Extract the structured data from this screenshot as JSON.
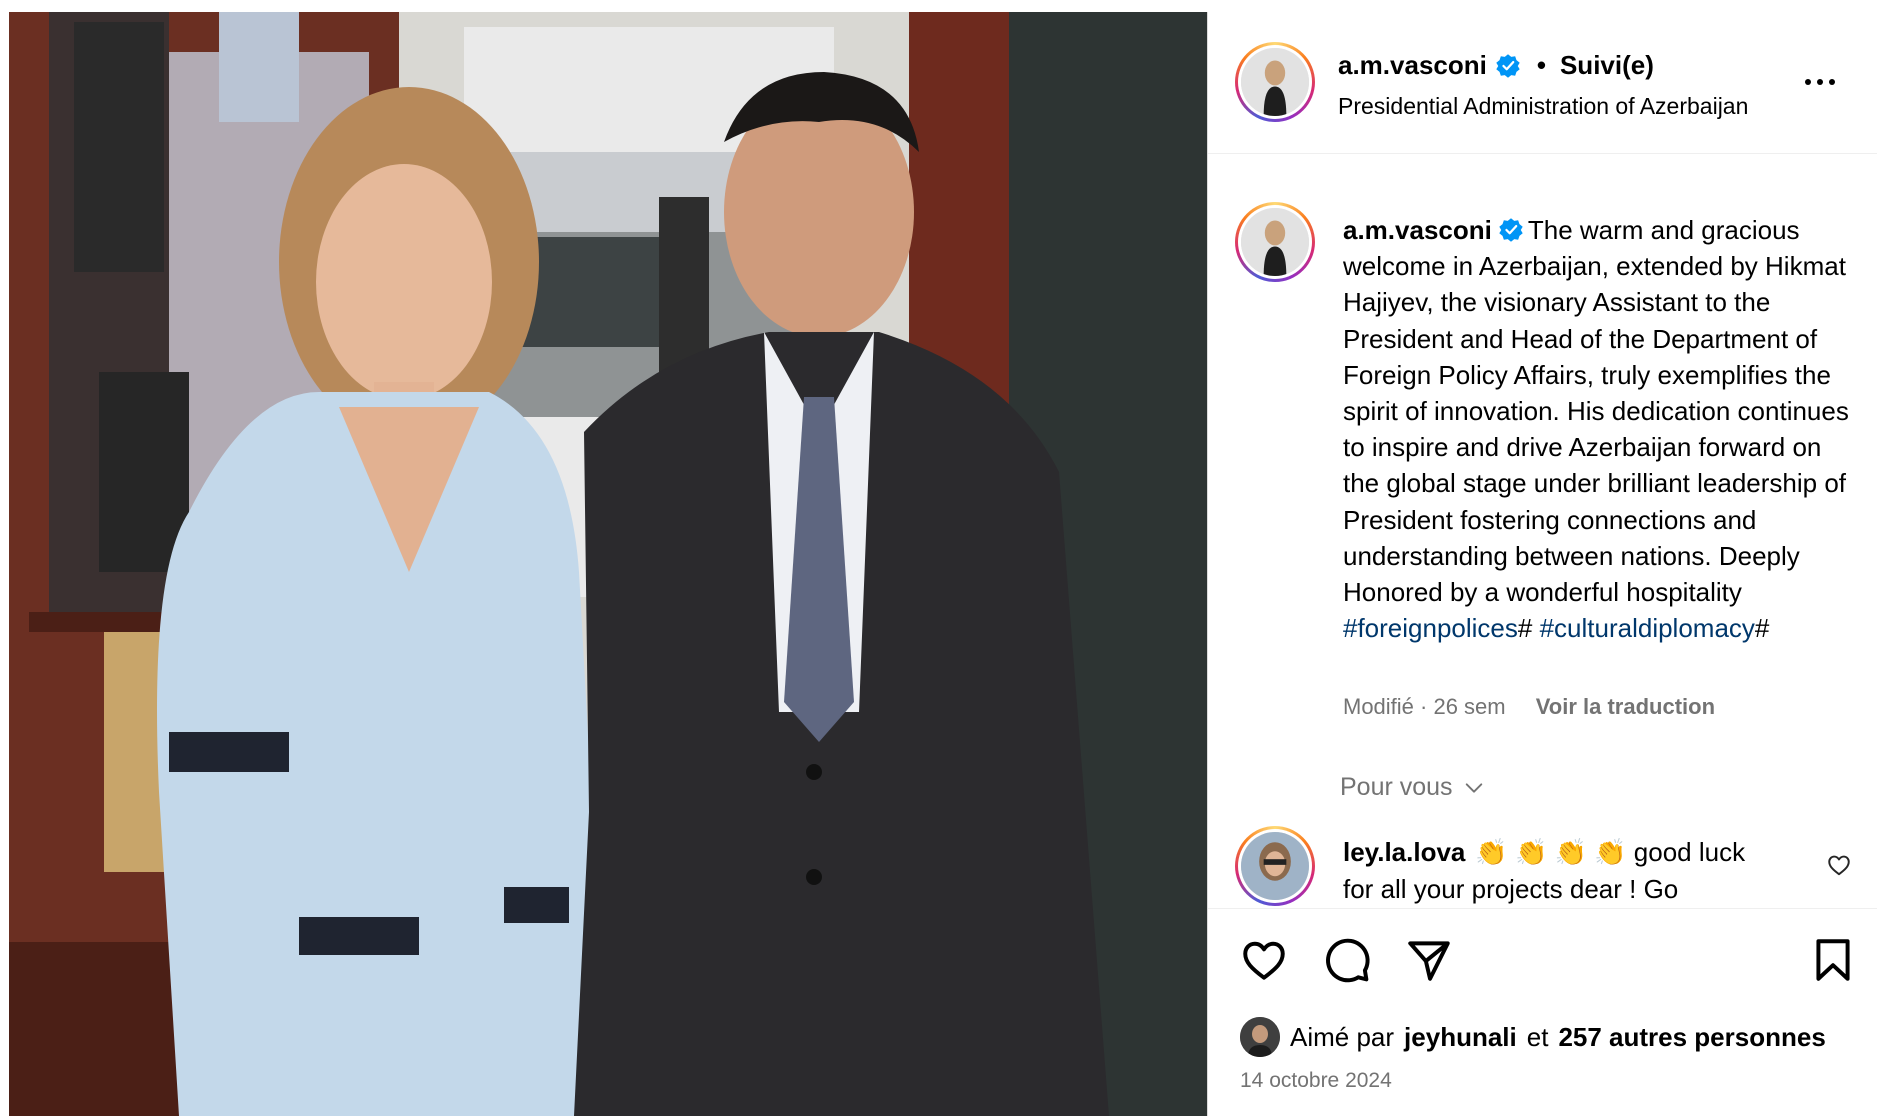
{
  "post": {
    "username": "a.m.vasconi",
    "follow_status": "Suivi(e)",
    "location": "Presidential Administration of Azerbaijan",
    "caption": {
      "username": "a.m.vasconi",
      "text": "The warm and gracious welcome in Azerbaijan, extended by Hikmat Hajiyev, the visionary Assistant to the President and Head of the Department of Foreign Policy Affairs, truly exemplifies the spirit of innovation. His dedication continues to inspire and drive Azerbaijan forward on the global stage under brilliant leadership of President fostering connections and understanding between nations. Deeply Honored by a wonderful hospitality",
      "hashtag_1": "#foreignpolices",
      "hashtag_1_suffix": "# ",
      "hashtag_2": "#culturaldiplomacy",
      "hashtag_2_suffix": "#",
      "edited": "Modifié · 26 sem",
      "translate": "Voir la traduction"
    },
    "for_you_label": "Pour vous",
    "comment": {
      "username": "ley.la.lova",
      "emojis": "👏 👏 👏 👏",
      "text": "good luck for all your projects dear ! Go"
    },
    "likes": {
      "prefix": "Aimé par",
      "user": "jeyhunali",
      "joiner": "et",
      "others": "257 autres personnes"
    },
    "date": "14 octobre 2024"
  },
  "icons": {
    "more": "more-horizontal-icon",
    "verified": "verified-badge-icon",
    "chevron": "chevron-down-icon",
    "heart": "heart-icon",
    "comment": "comment-bubble-icon",
    "share": "paper-plane-icon",
    "save": "bookmark-icon"
  },
  "colors": {
    "verified": "#0095f6",
    "hashtag": "#00376b",
    "secondary_text": "#737373"
  }
}
